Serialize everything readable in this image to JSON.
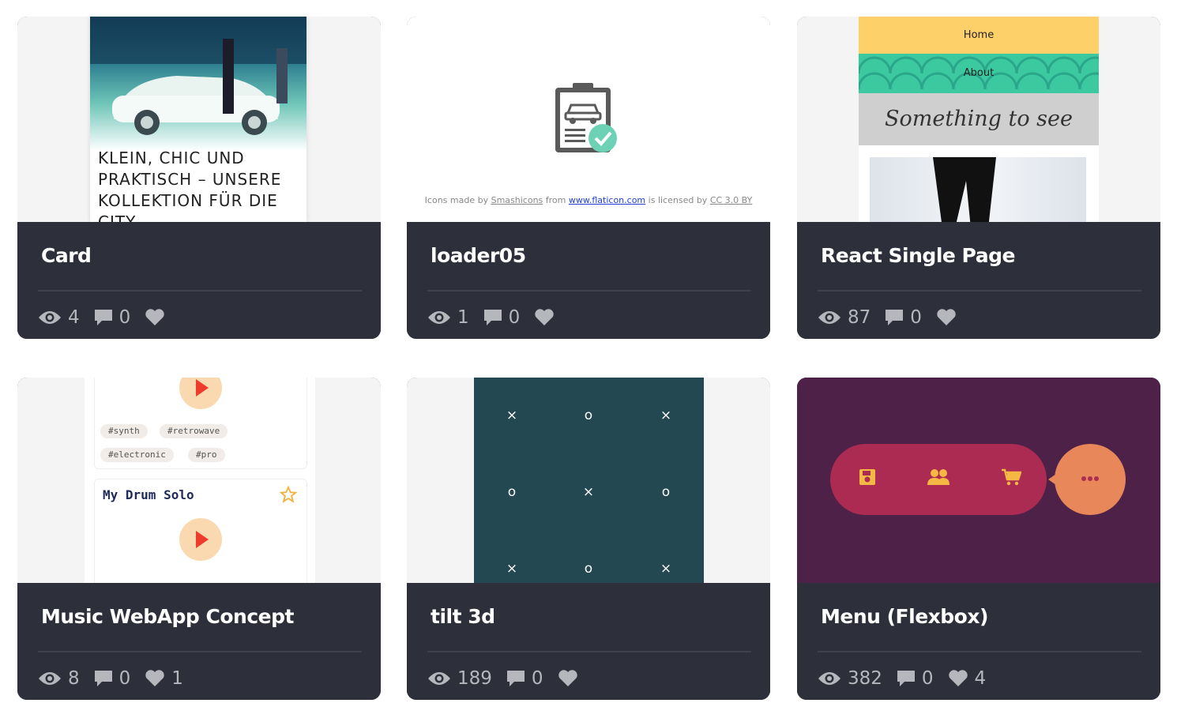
{
  "cards": [
    {
      "title": "Card",
      "views": "4",
      "comments": "0",
      "likes": "",
      "preview": {
        "headline": "KLEIN, CHIC UND PRAKTISCH – UNSERE KOLLEKTION FÜR DIE CITY"
      }
    },
    {
      "title": "loader05",
      "views": "1",
      "comments": "0",
      "likes": "",
      "preview": {
        "credit_prefix": "Icons made by",
        "credit_author": "Smashicons",
        "credit_from": "from",
        "credit_site": "www.flaticon.com",
        "credit_licensed": "is licensed by",
        "credit_license": "CC 3.0 BY"
      }
    },
    {
      "title": "React Single Page",
      "views": "87",
      "comments": "0",
      "likes": "",
      "preview": {
        "nav_home": "Home",
        "nav_about": "About",
        "hero_text": "Something to see"
      }
    },
    {
      "title": "Music WebApp Concept",
      "views": "8",
      "comments": "0",
      "likes": "1",
      "preview": {
        "tags": [
          "#synth",
          "#retrowave",
          "#electronic",
          "#pro"
        ],
        "song_title": "My Drum Solo"
      }
    },
    {
      "title": "tilt 3d",
      "views": "189",
      "comments": "0",
      "likes": "",
      "preview": {
        "cells": [
          "×",
          "o",
          "×",
          "o",
          "×",
          "o",
          "×",
          "o",
          "×"
        ]
      }
    },
    {
      "title": "Menu (Flexbox)",
      "views": "382",
      "comments": "0",
      "likes": "4",
      "preview": {
        "icons": [
          "save-icon",
          "users-icon",
          "cart-icon",
          "more-icon"
        ]
      }
    }
  ],
  "colors": {
    "card_bg": "#2d2f3a",
    "stat_text": "#b5b7bd",
    "menu_bg": "#4e2148",
    "menu_pill": "#ac2b52",
    "menu_circle": "#e8885a",
    "board_bg": "#234852"
  }
}
